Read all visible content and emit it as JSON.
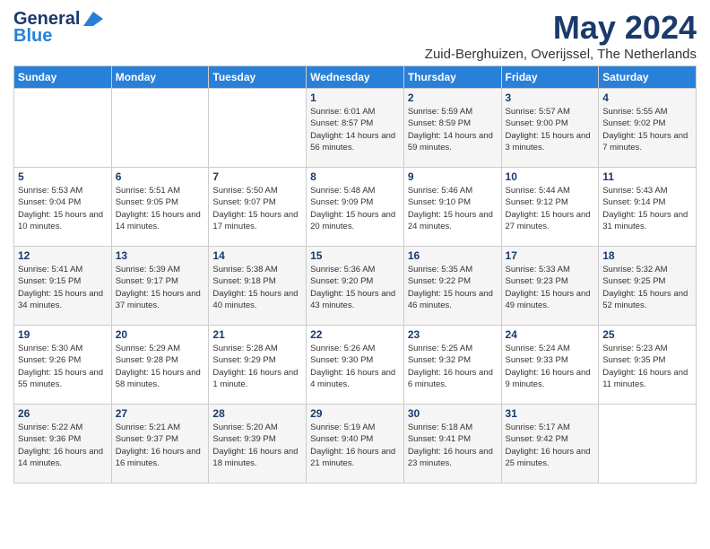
{
  "header": {
    "logo_line1": "General",
    "logo_line2": "Blue",
    "month": "May 2024",
    "location": "Zuid-Berghuizen, Overijssel, The Netherlands"
  },
  "days_of_week": [
    "Sunday",
    "Monday",
    "Tuesday",
    "Wednesday",
    "Thursday",
    "Friday",
    "Saturday"
  ],
  "weeks": [
    [
      {
        "num": "",
        "sunrise": "",
        "sunset": "",
        "daylight": "",
        "empty": true
      },
      {
        "num": "",
        "sunrise": "",
        "sunset": "",
        "daylight": "",
        "empty": true
      },
      {
        "num": "",
        "sunrise": "",
        "sunset": "",
        "daylight": "",
        "empty": true
      },
      {
        "num": "1",
        "sunrise": "Sunrise: 6:01 AM",
        "sunset": "Sunset: 8:57 PM",
        "daylight": "Daylight: 14 hours and 56 minutes."
      },
      {
        "num": "2",
        "sunrise": "Sunrise: 5:59 AM",
        "sunset": "Sunset: 8:59 PM",
        "daylight": "Daylight: 14 hours and 59 minutes."
      },
      {
        "num": "3",
        "sunrise": "Sunrise: 5:57 AM",
        "sunset": "Sunset: 9:00 PM",
        "daylight": "Daylight: 15 hours and 3 minutes."
      },
      {
        "num": "4",
        "sunrise": "Sunrise: 5:55 AM",
        "sunset": "Sunset: 9:02 PM",
        "daylight": "Daylight: 15 hours and 7 minutes."
      }
    ],
    [
      {
        "num": "5",
        "sunrise": "Sunrise: 5:53 AM",
        "sunset": "Sunset: 9:04 PM",
        "daylight": "Daylight: 15 hours and 10 minutes."
      },
      {
        "num": "6",
        "sunrise": "Sunrise: 5:51 AM",
        "sunset": "Sunset: 9:05 PM",
        "daylight": "Daylight: 15 hours and 14 minutes."
      },
      {
        "num": "7",
        "sunrise": "Sunrise: 5:50 AM",
        "sunset": "Sunset: 9:07 PM",
        "daylight": "Daylight: 15 hours and 17 minutes."
      },
      {
        "num": "8",
        "sunrise": "Sunrise: 5:48 AM",
        "sunset": "Sunset: 9:09 PM",
        "daylight": "Daylight: 15 hours and 20 minutes."
      },
      {
        "num": "9",
        "sunrise": "Sunrise: 5:46 AM",
        "sunset": "Sunset: 9:10 PM",
        "daylight": "Daylight: 15 hours and 24 minutes."
      },
      {
        "num": "10",
        "sunrise": "Sunrise: 5:44 AM",
        "sunset": "Sunset: 9:12 PM",
        "daylight": "Daylight: 15 hours and 27 minutes."
      },
      {
        "num": "11",
        "sunrise": "Sunrise: 5:43 AM",
        "sunset": "Sunset: 9:14 PM",
        "daylight": "Daylight: 15 hours and 31 minutes."
      }
    ],
    [
      {
        "num": "12",
        "sunrise": "Sunrise: 5:41 AM",
        "sunset": "Sunset: 9:15 PM",
        "daylight": "Daylight: 15 hours and 34 minutes."
      },
      {
        "num": "13",
        "sunrise": "Sunrise: 5:39 AM",
        "sunset": "Sunset: 9:17 PM",
        "daylight": "Daylight: 15 hours and 37 minutes."
      },
      {
        "num": "14",
        "sunrise": "Sunrise: 5:38 AM",
        "sunset": "Sunset: 9:18 PM",
        "daylight": "Daylight: 15 hours and 40 minutes."
      },
      {
        "num": "15",
        "sunrise": "Sunrise: 5:36 AM",
        "sunset": "Sunset: 9:20 PM",
        "daylight": "Daylight: 15 hours and 43 minutes."
      },
      {
        "num": "16",
        "sunrise": "Sunrise: 5:35 AM",
        "sunset": "Sunset: 9:22 PM",
        "daylight": "Daylight: 15 hours and 46 minutes."
      },
      {
        "num": "17",
        "sunrise": "Sunrise: 5:33 AM",
        "sunset": "Sunset: 9:23 PM",
        "daylight": "Daylight: 15 hours and 49 minutes."
      },
      {
        "num": "18",
        "sunrise": "Sunrise: 5:32 AM",
        "sunset": "Sunset: 9:25 PM",
        "daylight": "Daylight: 15 hours and 52 minutes."
      }
    ],
    [
      {
        "num": "19",
        "sunrise": "Sunrise: 5:30 AM",
        "sunset": "Sunset: 9:26 PM",
        "daylight": "Daylight: 15 hours and 55 minutes."
      },
      {
        "num": "20",
        "sunrise": "Sunrise: 5:29 AM",
        "sunset": "Sunset: 9:28 PM",
        "daylight": "Daylight: 15 hours and 58 minutes."
      },
      {
        "num": "21",
        "sunrise": "Sunrise: 5:28 AM",
        "sunset": "Sunset: 9:29 PM",
        "daylight": "Daylight: 16 hours and 1 minute."
      },
      {
        "num": "22",
        "sunrise": "Sunrise: 5:26 AM",
        "sunset": "Sunset: 9:30 PM",
        "daylight": "Daylight: 16 hours and 4 minutes."
      },
      {
        "num": "23",
        "sunrise": "Sunrise: 5:25 AM",
        "sunset": "Sunset: 9:32 PM",
        "daylight": "Daylight: 16 hours and 6 minutes."
      },
      {
        "num": "24",
        "sunrise": "Sunrise: 5:24 AM",
        "sunset": "Sunset: 9:33 PM",
        "daylight": "Daylight: 16 hours and 9 minutes."
      },
      {
        "num": "25",
        "sunrise": "Sunrise: 5:23 AM",
        "sunset": "Sunset: 9:35 PM",
        "daylight": "Daylight: 16 hours and 11 minutes."
      }
    ],
    [
      {
        "num": "26",
        "sunrise": "Sunrise: 5:22 AM",
        "sunset": "Sunset: 9:36 PM",
        "daylight": "Daylight: 16 hours and 14 minutes."
      },
      {
        "num": "27",
        "sunrise": "Sunrise: 5:21 AM",
        "sunset": "Sunset: 9:37 PM",
        "daylight": "Daylight: 16 hours and 16 minutes."
      },
      {
        "num": "28",
        "sunrise": "Sunrise: 5:20 AM",
        "sunset": "Sunset: 9:39 PM",
        "daylight": "Daylight: 16 hours and 18 minutes."
      },
      {
        "num": "29",
        "sunrise": "Sunrise: 5:19 AM",
        "sunset": "Sunset: 9:40 PM",
        "daylight": "Daylight: 16 hours and 21 minutes."
      },
      {
        "num": "30",
        "sunrise": "Sunrise: 5:18 AM",
        "sunset": "Sunset: 9:41 PM",
        "daylight": "Daylight: 16 hours and 23 minutes."
      },
      {
        "num": "31",
        "sunrise": "Sunrise: 5:17 AM",
        "sunset": "Sunset: 9:42 PM",
        "daylight": "Daylight: 16 hours and 25 minutes."
      },
      {
        "num": "",
        "sunrise": "",
        "sunset": "",
        "daylight": "",
        "empty": true
      }
    ]
  ]
}
